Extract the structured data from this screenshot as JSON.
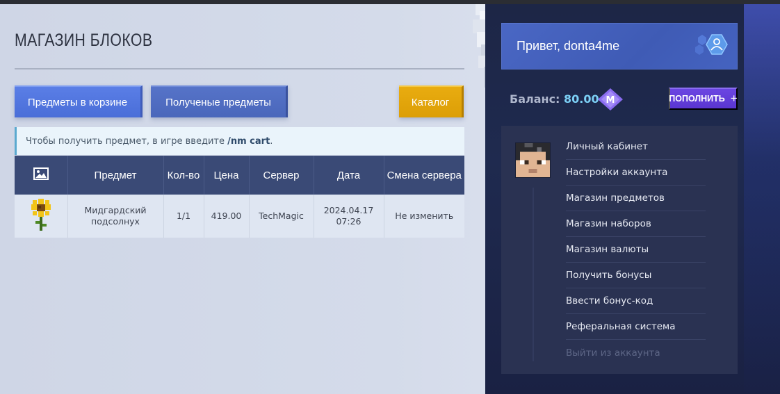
{
  "page": {
    "title": "МАГАЗИН БЛОКОВ"
  },
  "buttons": {
    "cart": "Предметы в корзине",
    "received": "Полученые предметы",
    "catalog": "Каталог"
  },
  "notice": {
    "text": "Чтобы получить предмет, в игре введите ",
    "command": "/nm cart",
    "suffix": "."
  },
  "table": {
    "headers": [
      "Предмет",
      "Кол-во",
      "Цена",
      "Сервер",
      "Дата",
      "Смена сервера"
    ],
    "rows": [
      {
        "item": "Мидгардский подсолнух",
        "qty": "1/1",
        "price": "419.00",
        "server": "TechMagic",
        "date": "2024.04.17",
        "time": "07:26",
        "change": "Не изменить"
      }
    ]
  },
  "sidebar": {
    "greeting": "Привет, donta4me",
    "balance_label": "Баланс: ",
    "balance_value": "80.00",
    "topup_label": "ПОПОЛНИТЬ",
    "topup_icon": "+",
    "menu": [
      "Личный кабинет",
      "Настройки аккаунта",
      "Магазин предметов",
      "Магазин наборов",
      "Магазин валюты",
      "Получить бонусы",
      "Ввести бонус-код",
      "Реферальная система",
      "Выйти из аккаунта"
    ]
  },
  "icons": {
    "image_header": "image-icon",
    "user": "user-icon",
    "gem": "currency-gem-icon"
  }
}
